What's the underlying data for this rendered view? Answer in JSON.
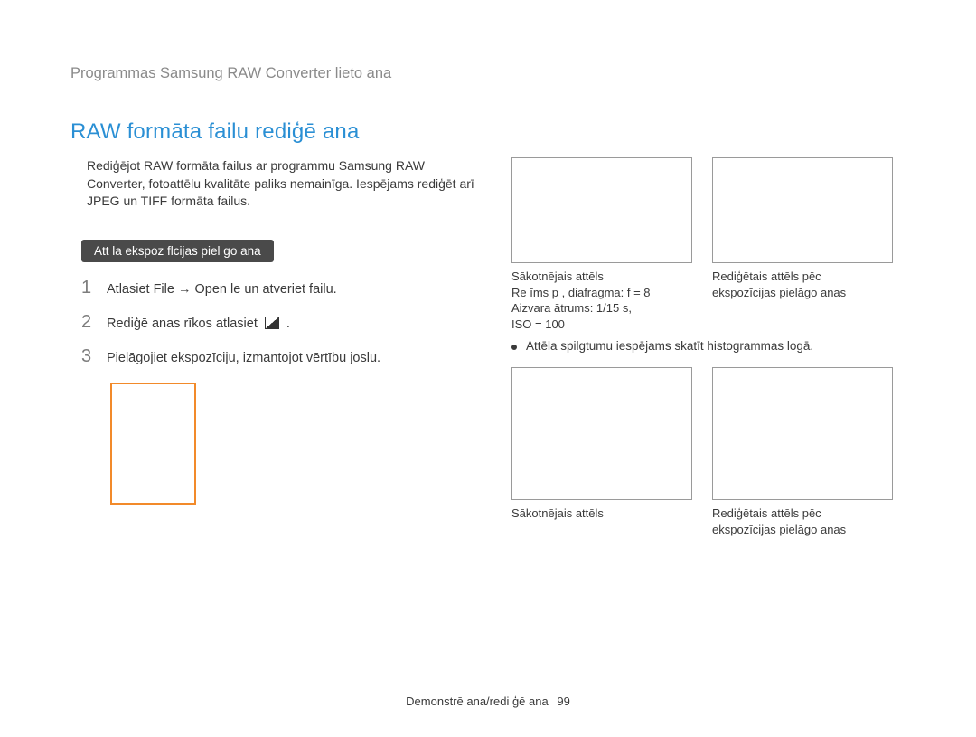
{
  "header": {
    "breadcrumb": "Programmas Samsung RAW Converter lieto ana"
  },
  "section": {
    "title": "RAW formāta failu rediģē ana",
    "intro": "Rediģējot RAW formāta failus ar programmu Samsung RAW Converter, fotoattēlu kvalitāte paliks nemainīga. Iespējams rediģēt arī JPEG un TIFF formāta failus.",
    "badge": "Att la ekspoz flcijas piel go ana"
  },
  "steps": [
    {
      "num": "1",
      "prefix": "Atlasiet File ",
      "arrow": "→",
      "suffix": " Open  le un atveriet failu."
    },
    {
      "num": "2",
      "prefix": "Rediģē anas rīkos atlasiet ",
      "arrow": "",
      "suffix": " ."
    },
    {
      "num": "3",
      "prefix": "Pielāgojiet ekspozīciju, izmantojot vērtību joslu.",
      "arrow": "",
      "suffix": ""
    }
  ],
  "right": {
    "row1": {
      "caption1_line1": "Sākotnējais attēls",
      "caption1_line2": "Re īms p , diafragma: f = 8",
      "caption1_line3": "Aizvara ātrums: 1/15 s,",
      "caption1_line4": "ISO = 100",
      "caption2_line1": "Rediģētais attēls pēc",
      "caption2_line2": "ekspozīcijas pielāgo anas"
    },
    "bullet": "Attēla spilgtumu iespējams skatīt histogrammas logā.",
    "row2": {
      "caption1": "Sākotnējais attēls",
      "caption2_line1": "Rediģētais attēls pēc",
      "caption2_line2": "ekspozīcijas pielāgo anas"
    }
  },
  "footer": {
    "text": "Demonstrē ana/redi ģē ana",
    "page": "99"
  }
}
